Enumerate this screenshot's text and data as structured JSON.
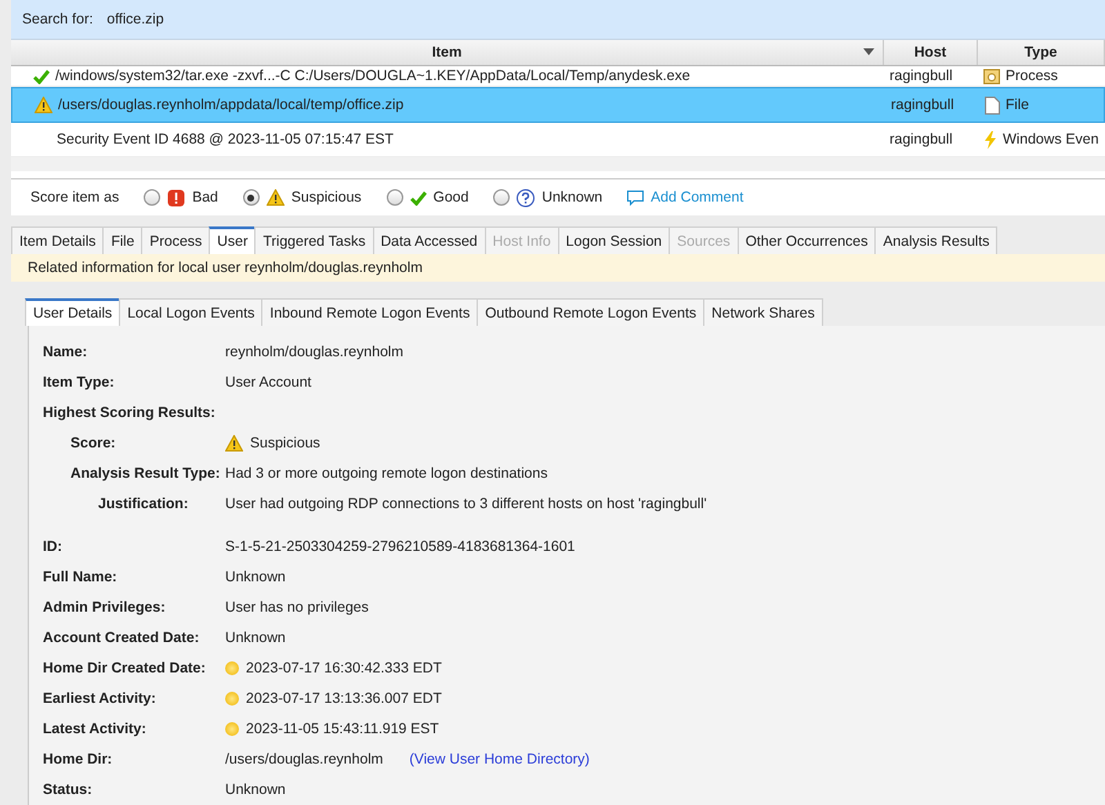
{
  "search": {
    "label": "Search for:",
    "value": "office.zip"
  },
  "table": {
    "columns": [
      "Item",
      "Host",
      "Type"
    ],
    "rows": [
      {
        "item": {
          "label": "/windows/system32/tar.exe -zxvf...-C C:/Users/DOUGLA~1.KEY/AppData/Local/Temp/anydesk.exe",
          "kind": "good"
        },
        "host": "ragingbull",
        "type": {
          "label": "Process",
          "kind": "process"
        },
        "selected": false,
        "partial": true
      },
      {
        "item": {
          "label": "/users/douglas.reynholm/appdata/local/temp/office.zip",
          "kind": "suspicious"
        },
        "host": "ragingbull",
        "type": {
          "label": "File",
          "kind": "file"
        },
        "selected": true,
        "partial": false
      },
      {
        "item": {
          "label": "Security Event ID 4688 @ 2023-11-05 07:15:47 EST",
          "kind": "plain"
        },
        "host": "ragingbull",
        "type": {
          "label": "Windows Even",
          "kind": "event"
        },
        "selected": false,
        "partial": false
      }
    ]
  },
  "score_bar": {
    "label": "Score item as",
    "options": [
      {
        "label": "Bad",
        "kind": "bad",
        "selected": false
      },
      {
        "label": "Suspicious",
        "kind": "suspicious",
        "selected": true
      },
      {
        "label": "Good",
        "kind": "good",
        "selected": false
      },
      {
        "label": "Unknown",
        "kind": "unknown",
        "selected": false
      }
    ],
    "comment": "Add Comment"
  },
  "tabs": [
    {
      "label": "Item Details",
      "selected": false,
      "disabled": false
    },
    {
      "label": "File",
      "selected": false,
      "disabled": false
    },
    {
      "label": "Process",
      "selected": false,
      "disabled": false
    },
    {
      "label": "User",
      "selected": true,
      "disabled": false
    },
    {
      "label": "Triggered Tasks",
      "selected": false,
      "disabled": false
    },
    {
      "label": "Data Accessed",
      "selected": false,
      "disabled": false
    },
    {
      "label": "Host Info",
      "selected": false,
      "disabled": true
    },
    {
      "label": "Logon Session",
      "selected": false,
      "disabled": false
    },
    {
      "label": "Sources",
      "selected": false,
      "disabled": true
    },
    {
      "label": "Other Occurrences",
      "selected": false,
      "disabled": false
    },
    {
      "label": "Analysis Results",
      "selected": false,
      "disabled": false
    }
  ],
  "banner": "Related information for local user reynholm/douglas.reynholm",
  "sub_tabs": [
    {
      "label": "User Details",
      "selected": true
    },
    {
      "label": "Local Logon Events",
      "selected": false
    },
    {
      "label": "Inbound Remote Logon Events",
      "selected": false
    },
    {
      "label": "Outbound Remote Logon Events",
      "selected": false
    },
    {
      "label": "Network Shares",
      "selected": false
    }
  ],
  "details": [
    {
      "rows": [
        {
          "label": "Name:",
          "kind": "text",
          "value": "reynholm/douglas.reynholm"
        },
        {
          "label": "Item Type:",
          "kind": "text",
          "value": "User Account"
        },
        {
          "label": "Highest Scoring Results:",
          "kind": "heading",
          "children": [
            {
              "label": "Score:",
              "kind": "score",
              "value": "Suspicious"
            },
            {
              "label": "Analysis Result Type:",
              "kind": "text",
              "value": "Had 3 or more outgoing remote logon destinations",
              "children": [
                {
                  "label": "Justification:",
                  "kind": "text",
                  "value": "User had outgoing RDP connections to 3 different hosts on host 'ragingbull'"
                }
              ]
            }
          ]
        }
      ]
    },
    {
      "rows": [
        {
          "label": "ID:",
          "kind": "text",
          "value": "S-1-5-21-2503304259-2796210589-4183681364-1601"
        },
        {
          "label": "Full Name:",
          "kind": "text",
          "value": "Unknown"
        },
        {
          "label": "Admin Privileges:",
          "kind": "text",
          "value": "User has no privileges"
        },
        {
          "label": "Account Created Date:",
          "kind": "text",
          "value": "Unknown"
        },
        {
          "label": "Home Dir Created Date:",
          "kind": "date",
          "value": "2023-07-17 16:30:42.333 EDT"
        },
        {
          "label": "Earliest Activity:",
          "kind": "date",
          "value": "2023-07-17 13:13:36.007 EDT"
        },
        {
          "label": "Latest Activity:",
          "kind": "date",
          "value": "2023-11-05 15:43:11.919 EST"
        },
        {
          "label": "Home Dir:",
          "kind": "link",
          "value": "/users/douglas.reynholm",
          "link": "(View User Home Directory)"
        },
        {
          "label": "Status:",
          "kind": "text",
          "value": "Unknown"
        }
      ]
    }
  ]
}
